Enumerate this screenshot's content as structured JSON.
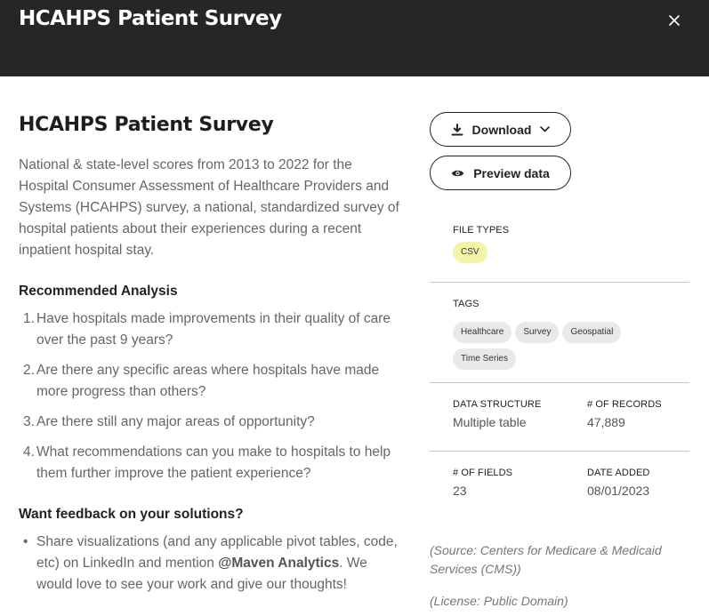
{
  "header": {
    "title": "HCAHPS Patient Survey"
  },
  "dataset": {
    "title": "HCAHPS Patient Survey",
    "description": "National & state-level scores from 2013 to 2022 for the Hospital Consumer Assessment of Healthcare Providers and Systems (HCAHPS) survey, a national, standardized survey of hospital patients about their experiences during a recent inpatient hospital stay."
  },
  "recommended": {
    "heading": "Recommended Analysis",
    "items": [
      {
        "num": "1.",
        "text": "Have hospitals made improvements in their quality of care over the past 9 years?"
      },
      {
        "num": "2.",
        "text": "Are there any specific areas where hospitals have made more progress than others?"
      },
      {
        "num": "3.",
        "text": "Are there still any major areas of opportunity?"
      },
      {
        "num": "4.",
        "text": "What recommendations can you make to hospitals to help them further improve the patient experience?"
      }
    ]
  },
  "feedback": {
    "heading": "Want feedback on your solutions?",
    "bullet": "•",
    "text_before": "Share visualizations (and any applicable pivot tables, code, etc) on LinkedIn and mention ",
    "mention": "@Maven Analytics",
    "text_after": ". We would love to see your work and give our thoughts!"
  },
  "actions": {
    "download_label": "Download",
    "preview_label": "Preview data"
  },
  "meta": {
    "file_types_label": "FILE TYPES",
    "file_types": [
      "CSV"
    ],
    "tags_label": "TAGS",
    "tags": [
      "Healthcare",
      "Survey",
      "Geospatial",
      "Time Series"
    ],
    "data_structure_label": "DATA STRUCTURE",
    "data_structure": "Multiple table",
    "records_label": "# OF RECORDS",
    "records": "47,889",
    "fields_label": "# OF FIELDS",
    "fields": "23",
    "date_added_label": "DATE ADDED",
    "date_added": "08/01/2023"
  },
  "source": "(Source: Centers for Medicare & Medicaid Services (CMS))",
  "license": "(License: Public Domain)",
  "icons": {
    "close": "close-icon",
    "download": "download-icon",
    "chevron": "chevron-down-icon",
    "eye": "eye-icon"
  },
  "colors": {
    "header_bg": "#262626",
    "csv_pill": "#f2f5a8",
    "tag_pill": "#e9e9e9"
  }
}
